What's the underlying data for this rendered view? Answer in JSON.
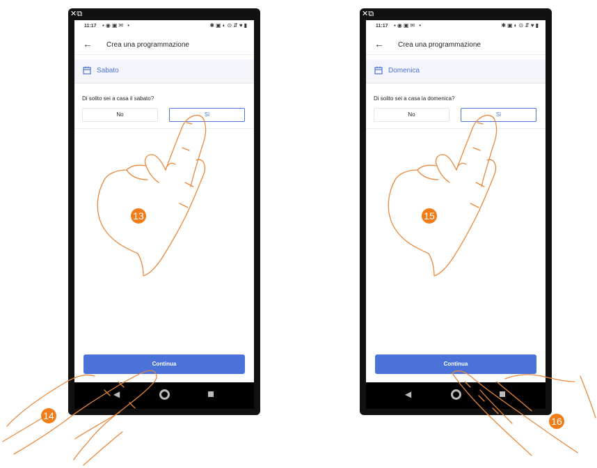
{
  "screens": [
    {
      "status_time": "11:17",
      "title": "Crea una programmazione",
      "day": "Sabato",
      "question": "Di solito sei a casa il sabato?",
      "option_no": "No",
      "option_si": "Sì",
      "continue_label": "Continua",
      "step_badges": [
        "13",
        "14"
      ]
    },
    {
      "status_time": "11:17",
      "title": "Crea una programmazione",
      "day": "Domenica",
      "question": "Di solito sei a casa la domenica?",
      "option_no": "No",
      "option_si": "Sì",
      "continue_label": "Continua",
      "step_badges": [
        "15",
        "16"
      ]
    }
  ],
  "colors": {
    "accent": "#4a72d8",
    "badge": "#f07d1a",
    "hand_outline": "#e8873a"
  },
  "icons": [
    "close-icon",
    "external-link-icon",
    "back-arrow-icon",
    "calendar-icon",
    "nav-back-icon",
    "nav-home-icon",
    "nav-recents-icon"
  ]
}
